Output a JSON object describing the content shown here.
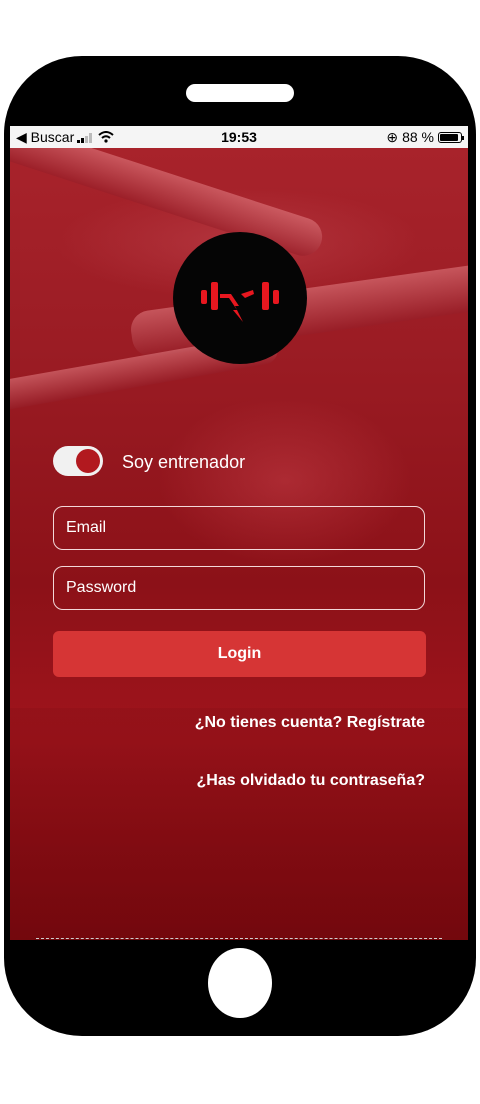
{
  "status_bar": {
    "back_label": "◀ Buscar",
    "time": "19:53",
    "battery": "88 %",
    "battery_level": 0.88
  },
  "theme": {
    "accent": "#d63535",
    "overlay": "#8c1118",
    "logo_bg": "#050505",
    "logo_icon": "#e8171f"
  },
  "logo": {
    "icon": "barbell-lightning-icon"
  },
  "trainer_toggle": {
    "label": "Soy entrenador",
    "on": true
  },
  "form": {
    "email_placeholder": "Email",
    "password_placeholder": "Password",
    "login_label": "Login"
  },
  "links": {
    "register": "¿No tienes cuenta? Regístrate",
    "forgot_password": "¿Has olvidado tu contraseña?"
  }
}
